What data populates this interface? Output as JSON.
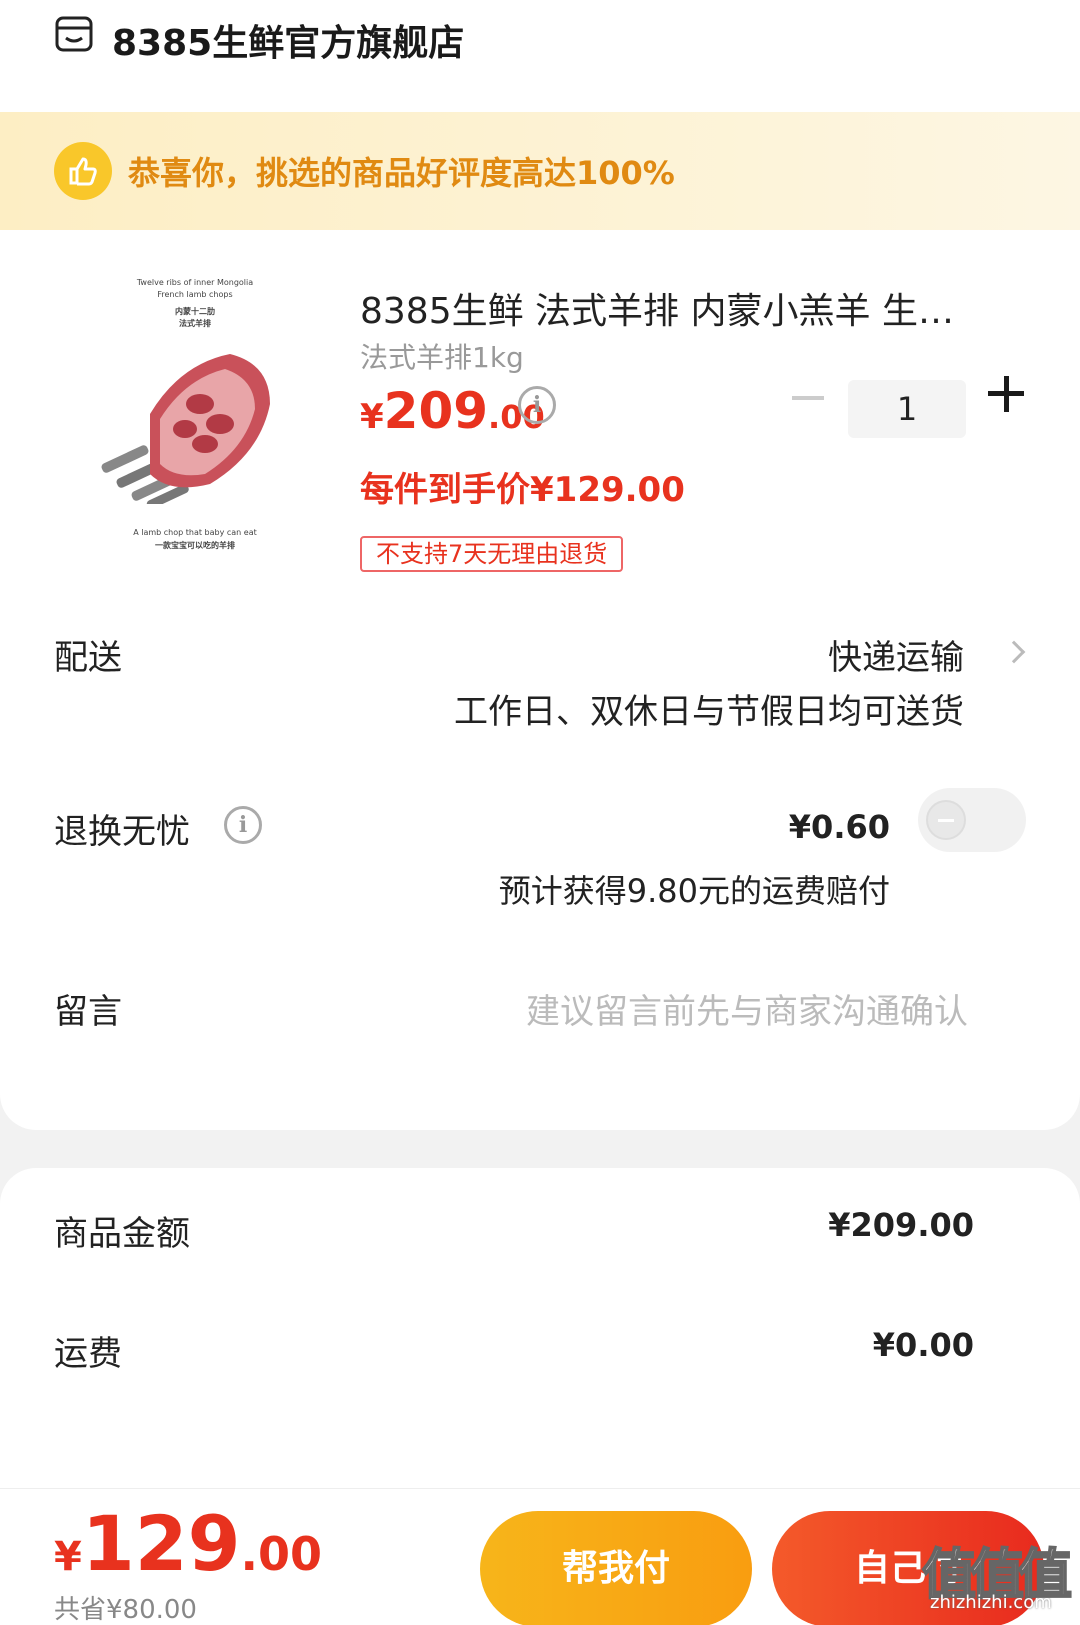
{
  "store": {
    "name": "8385生鲜官方旗舰店",
    "icon": "store-icon"
  },
  "banner": {
    "text": "恭喜你，挑选的商品好评度高达100%",
    "icon": "thumbs-up-icon"
  },
  "product": {
    "title": "8385生鲜 法式羊排 内蒙小羔羊  生…",
    "spec": "法式羊排1kg",
    "price_currency": "¥",
    "price_int": "209",
    "price_dec": ".00",
    "quantity": "1",
    "final_price": "每件到手价¥129.00",
    "return_tag": "不支持7天无理由退货",
    "image_text": {
      "line1": "Twelve ribs of inner Mongolia",
      "line2": "French lamb chops",
      "line3": "内蒙十二肋",
      "line4": "法式羊排",
      "line5": "A lamb chop that baby can eat",
      "line6": "一款宝宝可以吃的羊排"
    }
  },
  "delivery": {
    "label": "配送",
    "value": "快递运输",
    "sub": "工作日、双休日与节假日均可送货"
  },
  "worry_free": {
    "label": "退换无忧",
    "price": "¥0.60",
    "sub": "预计获得9.80元的运费赔付",
    "toggle_on": false
  },
  "message": {
    "label": "留言",
    "placeholder": "建议留言前先与商家沟通确认"
  },
  "summary": {
    "goods_label": "商品金额",
    "goods_value": "¥209.00",
    "shipping_label": "运费",
    "shipping_value": "¥0.00"
  },
  "footer": {
    "total_currency": "¥",
    "total_int": "129",
    "total_dec": ".00",
    "saved": "共省¥80.00",
    "help_pay": "帮我付",
    "self_pay": "自己付"
  },
  "watermark": {
    "text": "值值值",
    "sub": "zhizhizhi.com"
  },
  "colors": {
    "accent_red": "#e8321e",
    "accent_orange": "#f99d10",
    "banner_text": "#e08a12"
  }
}
